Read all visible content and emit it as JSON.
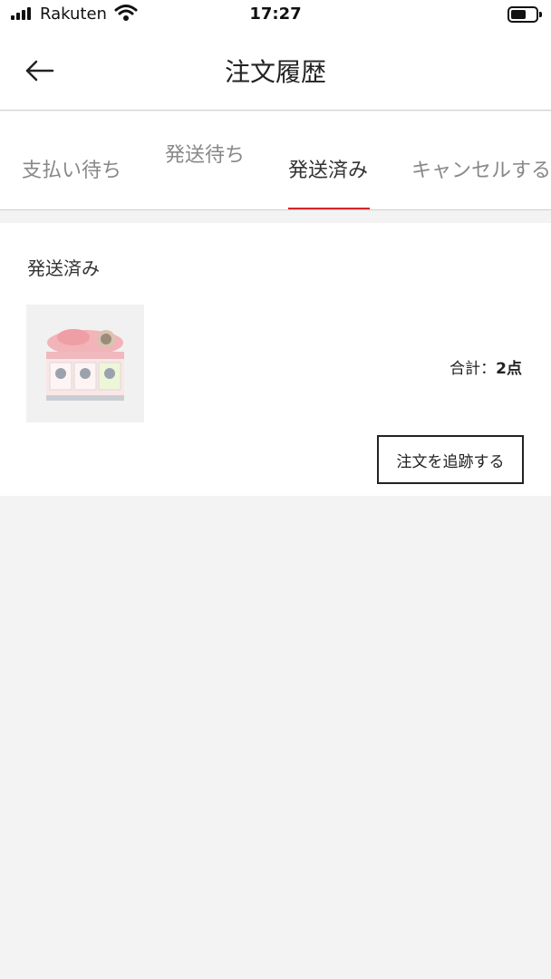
{
  "status_bar": {
    "carrier": "Rakuten",
    "time": "17:27"
  },
  "header": {
    "title": "注文履歴",
    "back_icon": "arrow-left-icon"
  },
  "tabs": [
    {
      "label": "支払い待ち",
      "active": false
    },
    {
      "label": "発送待ち",
      "active": false
    },
    {
      "label": "発送済み",
      "active": true
    },
    {
      "label": "キャンセルする",
      "active": false
    }
  ],
  "accent_color": "#d7252d",
  "order": {
    "section_title": "発送済み",
    "total_label": "合計：",
    "total_value": "2点",
    "track_button_label": "注文を追跡する"
  }
}
